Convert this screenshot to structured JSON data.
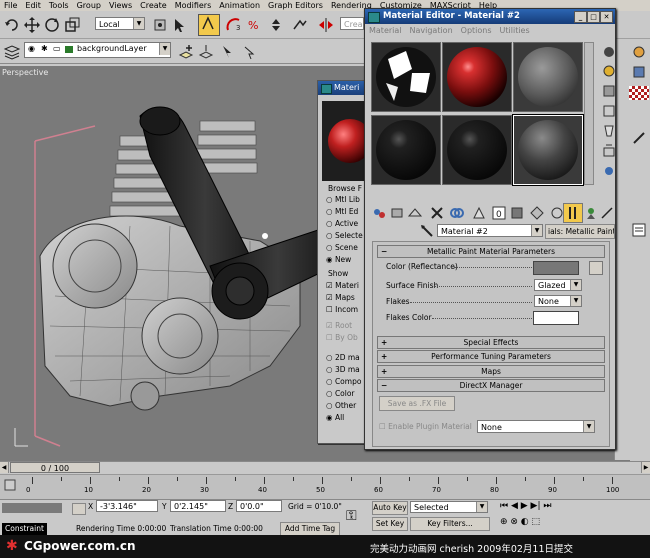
{
  "menubar": {
    "items": [
      "File",
      "Edit",
      "Tools",
      "Group",
      "Views",
      "Create",
      "Modifiers",
      "Animation",
      "Graph Editors",
      "Rendering",
      "Customize",
      "MAXScript",
      "Help"
    ]
  },
  "toolbar": {
    "coord_system": "Local",
    "search_placeholder": "Crea"
  },
  "layer_bar": {
    "layer": "backgroundLayer"
  },
  "viewport": {
    "label": "Perspective"
  },
  "back_dialog": {
    "title": "Materi",
    "browse_from_title": "Browse F",
    "browse_options": [
      "Mtl Lib",
      "Mtl Ed",
      "Active",
      "Selecte",
      "Scene",
      "New"
    ],
    "show_title": "Show",
    "show_options": [
      "Materi",
      "Maps",
      "Incom"
    ],
    "disabled_options": [
      "Root",
      "By Ob"
    ],
    "type_options": [
      "2D ma",
      "3D ma",
      "Compo",
      "Color",
      "Other",
      "All"
    ]
  },
  "material_editor": {
    "title": "Material Editor - Material #2",
    "menu": [
      "Material",
      "Navigation",
      "Options",
      "Utilities"
    ],
    "material_name": "Material #2",
    "material_type": "ials: Metallic Paint",
    "rollouts": {
      "params_title": "Metallic Paint Material Parameters",
      "special_effects": "Special Effects",
      "performance": "Performance Tuning Parameters",
      "maps": "Maps",
      "directx": "DirectX Manager"
    },
    "params": {
      "color_label": "Color (Reflectance)",
      "surface_label": "Surface Finish",
      "surface_value": "Glazed",
      "flakes_label": "Flakes",
      "flakes_value": "None",
      "flakes_color_label": "Flakes Color"
    },
    "directx": {
      "save_button": "Save as .FX File",
      "enable_plugin": "Enable Plugin Material",
      "plugin_value": "None"
    },
    "colors": {
      "color_swatch": "#777777",
      "flakes_swatch": "#ffffff"
    }
  },
  "timeline": {
    "frame_label": "0 / 100",
    "ticks": [
      "0",
      "10",
      "20",
      "30",
      "40",
      "50",
      "60",
      "70",
      "80",
      "90",
      "100"
    ]
  },
  "status": {
    "x_value": "-3'3.146\"",
    "y_value": "0'2.145\"",
    "z_value": "0'0.0\"",
    "grid": "Grid = 0'10.0\"",
    "auto_key": "Auto Key",
    "selected": "Selected",
    "set_key": "Set Key",
    "key_filters": "Key Filters...",
    "constraint": "Constraint",
    "rendering_time": "Rendering Time  0:00:00",
    "translation_time": "Translation Time  0:00:00",
    "add_time_tag": "Add Time Tag"
  },
  "footer": {
    "brand": "CGpower.com.cn",
    "caption": "完美动力动画网 cherish 2009年02月11日提交"
  }
}
